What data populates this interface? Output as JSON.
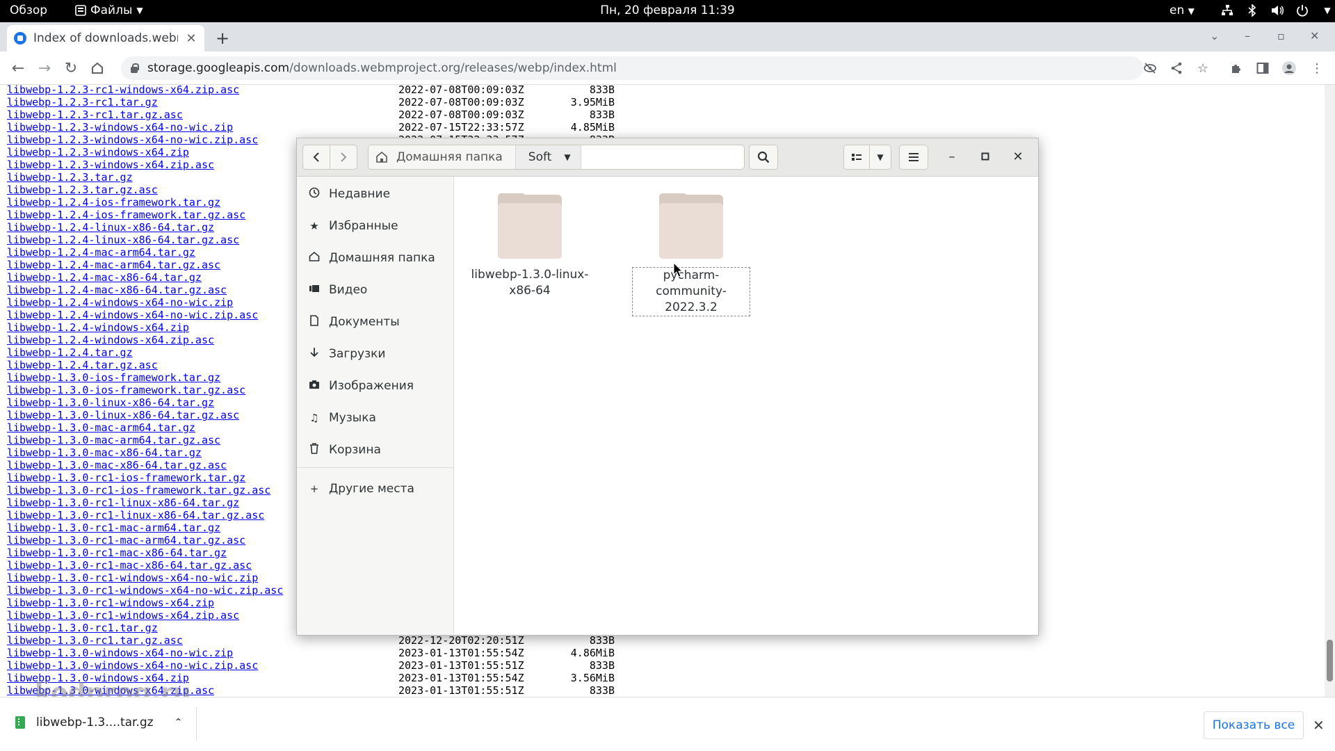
{
  "topbar": {
    "activities": "Обзор",
    "app_menu": "Файлы",
    "clock": "Пн, 20 февраля  11:39",
    "lang": "en"
  },
  "browser": {
    "tab_title": "Index of downloads.webm",
    "url_host": "storage.googleapis.com",
    "url_path": "/downloads.webmproject.org/releases/webp/index.html"
  },
  "listing": {
    "rows": [
      {
        "name": "libwebp-1.2.3-rc1-windows-x64.zip.asc",
        "date": "2022-07-08T00:09:03Z",
        "size": "833B"
      },
      {
        "name": "libwebp-1.2.3-rc1.tar.gz",
        "date": "2022-07-08T00:09:03Z",
        "size": "3.95MiB"
      },
      {
        "name": "libwebp-1.2.3-rc1.tar.gz.asc",
        "date": "2022-07-08T00:09:03Z",
        "size": "833B"
      },
      {
        "name": "libwebp-1.2.3-windows-x64-no-wic.zip",
        "date": "2022-07-15T22:33:57Z",
        "size": "4.85MiB"
      },
      {
        "name": "libwebp-1.2.3-windows-x64-no-wic.zip.asc",
        "date": "2022-07-15T22:33:57Z",
        "size": "833B"
      },
      {
        "name": "libwebp-1.2.3-windows-x64.zip",
        "date": "",
        "size": ""
      },
      {
        "name": "libwebp-1.2.3-windows-x64.zip.asc",
        "date": "",
        "size": ""
      },
      {
        "name": "libwebp-1.2.3.tar.gz",
        "date": "",
        "size": ""
      },
      {
        "name": "libwebp-1.2.3.tar.gz.asc",
        "date": "",
        "size": ""
      },
      {
        "name": "libwebp-1.2.4-ios-framework.tar.gz",
        "date": "",
        "size": ""
      },
      {
        "name": "libwebp-1.2.4-ios-framework.tar.gz.asc",
        "date": "",
        "size": ""
      },
      {
        "name": "libwebp-1.2.4-linux-x86-64.tar.gz",
        "date": "",
        "size": ""
      },
      {
        "name": "libwebp-1.2.4-linux-x86-64.tar.gz.asc",
        "date": "",
        "size": ""
      },
      {
        "name": "libwebp-1.2.4-mac-arm64.tar.gz",
        "date": "",
        "size": ""
      },
      {
        "name": "libwebp-1.2.4-mac-arm64.tar.gz.asc",
        "date": "",
        "size": ""
      },
      {
        "name": "libwebp-1.2.4-mac-x86-64.tar.gz",
        "date": "",
        "size": ""
      },
      {
        "name": "libwebp-1.2.4-mac-x86-64.tar.gz.asc",
        "date": "",
        "size": ""
      },
      {
        "name": "libwebp-1.2.4-windows-x64-no-wic.zip",
        "date": "",
        "size": ""
      },
      {
        "name": "libwebp-1.2.4-windows-x64-no-wic.zip.asc",
        "date": "",
        "size": ""
      },
      {
        "name": "libwebp-1.2.4-windows-x64.zip",
        "date": "",
        "size": ""
      },
      {
        "name": "libwebp-1.2.4-windows-x64.zip.asc",
        "date": "",
        "size": ""
      },
      {
        "name": "libwebp-1.2.4.tar.gz",
        "date": "",
        "size": ""
      },
      {
        "name": "libwebp-1.2.4.tar.gz.asc",
        "date": "",
        "size": ""
      },
      {
        "name": "libwebp-1.3.0-ios-framework.tar.gz",
        "date": "",
        "size": ""
      },
      {
        "name": "libwebp-1.3.0-ios-framework.tar.gz.asc",
        "date": "",
        "size": ""
      },
      {
        "name": "libwebp-1.3.0-linux-x86-64.tar.gz",
        "date": "",
        "size": ""
      },
      {
        "name": "libwebp-1.3.0-linux-x86-64.tar.gz.asc",
        "date": "",
        "size": ""
      },
      {
        "name": "libwebp-1.3.0-mac-arm64.tar.gz",
        "date": "",
        "size": ""
      },
      {
        "name": "libwebp-1.3.0-mac-arm64.tar.gz.asc",
        "date": "",
        "size": ""
      },
      {
        "name": "libwebp-1.3.0-mac-x86-64.tar.gz",
        "date": "",
        "size": ""
      },
      {
        "name": "libwebp-1.3.0-mac-x86-64.tar.gz.asc",
        "date": "",
        "size": ""
      },
      {
        "name": "libwebp-1.3.0-rc1-ios-framework.tar.gz",
        "date": "",
        "size": ""
      },
      {
        "name": "libwebp-1.3.0-rc1-ios-framework.tar.gz.asc",
        "date": "",
        "size": ""
      },
      {
        "name": "libwebp-1.3.0-rc1-linux-x86-64.tar.gz",
        "date": "",
        "size": ""
      },
      {
        "name": "libwebp-1.3.0-rc1-linux-x86-64.tar.gz.asc",
        "date": "",
        "size": ""
      },
      {
        "name": "libwebp-1.3.0-rc1-mac-arm64.tar.gz",
        "date": "",
        "size": ""
      },
      {
        "name": "libwebp-1.3.0-rc1-mac-arm64.tar.gz.asc",
        "date": "",
        "size": ""
      },
      {
        "name": "libwebp-1.3.0-rc1-mac-x86-64.tar.gz",
        "date": "",
        "size": ""
      },
      {
        "name": "libwebp-1.3.0-rc1-mac-x86-64.tar.gz.asc",
        "date": "",
        "size": ""
      },
      {
        "name": "libwebp-1.3.0-rc1-windows-x64-no-wic.zip",
        "date": "",
        "size": ""
      },
      {
        "name": "libwebp-1.3.0-rc1-windows-x64-no-wic.zip.asc",
        "date": "",
        "size": ""
      },
      {
        "name": "libwebp-1.3.0-rc1-windows-x64.zip",
        "date": "",
        "size": ""
      },
      {
        "name": "libwebp-1.3.0-rc1-windows-x64.zip.asc",
        "date": "",
        "size": ""
      },
      {
        "name": "libwebp-1.3.0-rc1.tar.gz",
        "date": "",
        "size": ""
      },
      {
        "name": "libwebp-1.3.0-rc1.tar.gz.asc",
        "date": "2022-12-20T02:20:51Z",
        "size": "833B"
      },
      {
        "name": "libwebp-1.3.0-windows-x64-no-wic.zip",
        "date": "2023-01-13T01:55:54Z",
        "size": "4.86MiB"
      },
      {
        "name": "libwebp-1.3.0-windows-x64-no-wic.zip.asc",
        "date": "2023-01-13T01:55:51Z",
        "size": "833B"
      },
      {
        "name": "libwebp-1.3.0-windows-x64.zip",
        "date": "2023-01-13T01:55:54Z",
        "size": "3.56MiB"
      },
      {
        "name": "libwebp-1.3.0-windows-x64.zip.asc",
        "date": "2023-01-13T01:55:51Z",
        "size": "833B"
      }
    ]
  },
  "downloads": {
    "item_label": "libwebp-1.3....tar.gz",
    "show_all": "Показать все"
  },
  "watermark": "kodprog.ru",
  "filemanager": {
    "home_crumb": "Домашняя папка",
    "current_crumb": "Soft",
    "sidebar": [
      {
        "label": "Недавние",
        "icon": "clock-icon"
      },
      {
        "label": "Избранные",
        "icon": "star-icon"
      },
      {
        "label": "Домашняя папка",
        "icon": "home-icon"
      },
      {
        "label": "Видео",
        "icon": "video-icon"
      },
      {
        "label": "Документы",
        "icon": "document-icon"
      },
      {
        "label": "Загрузки",
        "icon": "download-icon"
      },
      {
        "label": "Изображения",
        "icon": "camera-icon"
      },
      {
        "label": "Музыка",
        "icon": "music-icon"
      },
      {
        "label": "Корзина",
        "icon": "trash-icon"
      }
    ],
    "other_places": "Другие места",
    "folders": [
      {
        "line1": "libwebp-1.3.0-linux-",
        "line2": "x86-64"
      },
      {
        "line1": "pycharm-",
        "line2": "community-2022.3.2"
      }
    ]
  }
}
